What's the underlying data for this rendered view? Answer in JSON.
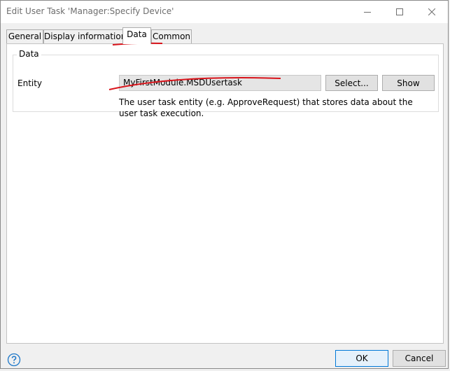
{
  "window": {
    "title": "Edit User Task 'Manager:Specify Device'"
  },
  "tabs": [
    {
      "label": "General",
      "active": false
    },
    {
      "label": "Display information",
      "active": false
    },
    {
      "label": "Data",
      "active": true
    },
    {
      "label": "Common",
      "active": false
    }
  ],
  "data_group": {
    "legend": "Data",
    "entity_label": "Entity",
    "entity_value": "MyFirstModule.MSDUsertask",
    "select_label": "Select...",
    "show_label": "Show",
    "hint": "The user task entity (e.g. ApproveRequest) that stores data about the user task execution."
  },
  "footer": {
    "ok_label": "OK",
    "cancel_label": "Cancel"
  },
  "colors": {
    "annotation": "#d9141b",
    "help_icon": "#1f78c8"
  },
  "icons": {
    "minimize": "minimize-icon",
    "maximize": "maximize-icon",
    "close": "close-icon",
    "help": "help-icon"
  }
}
